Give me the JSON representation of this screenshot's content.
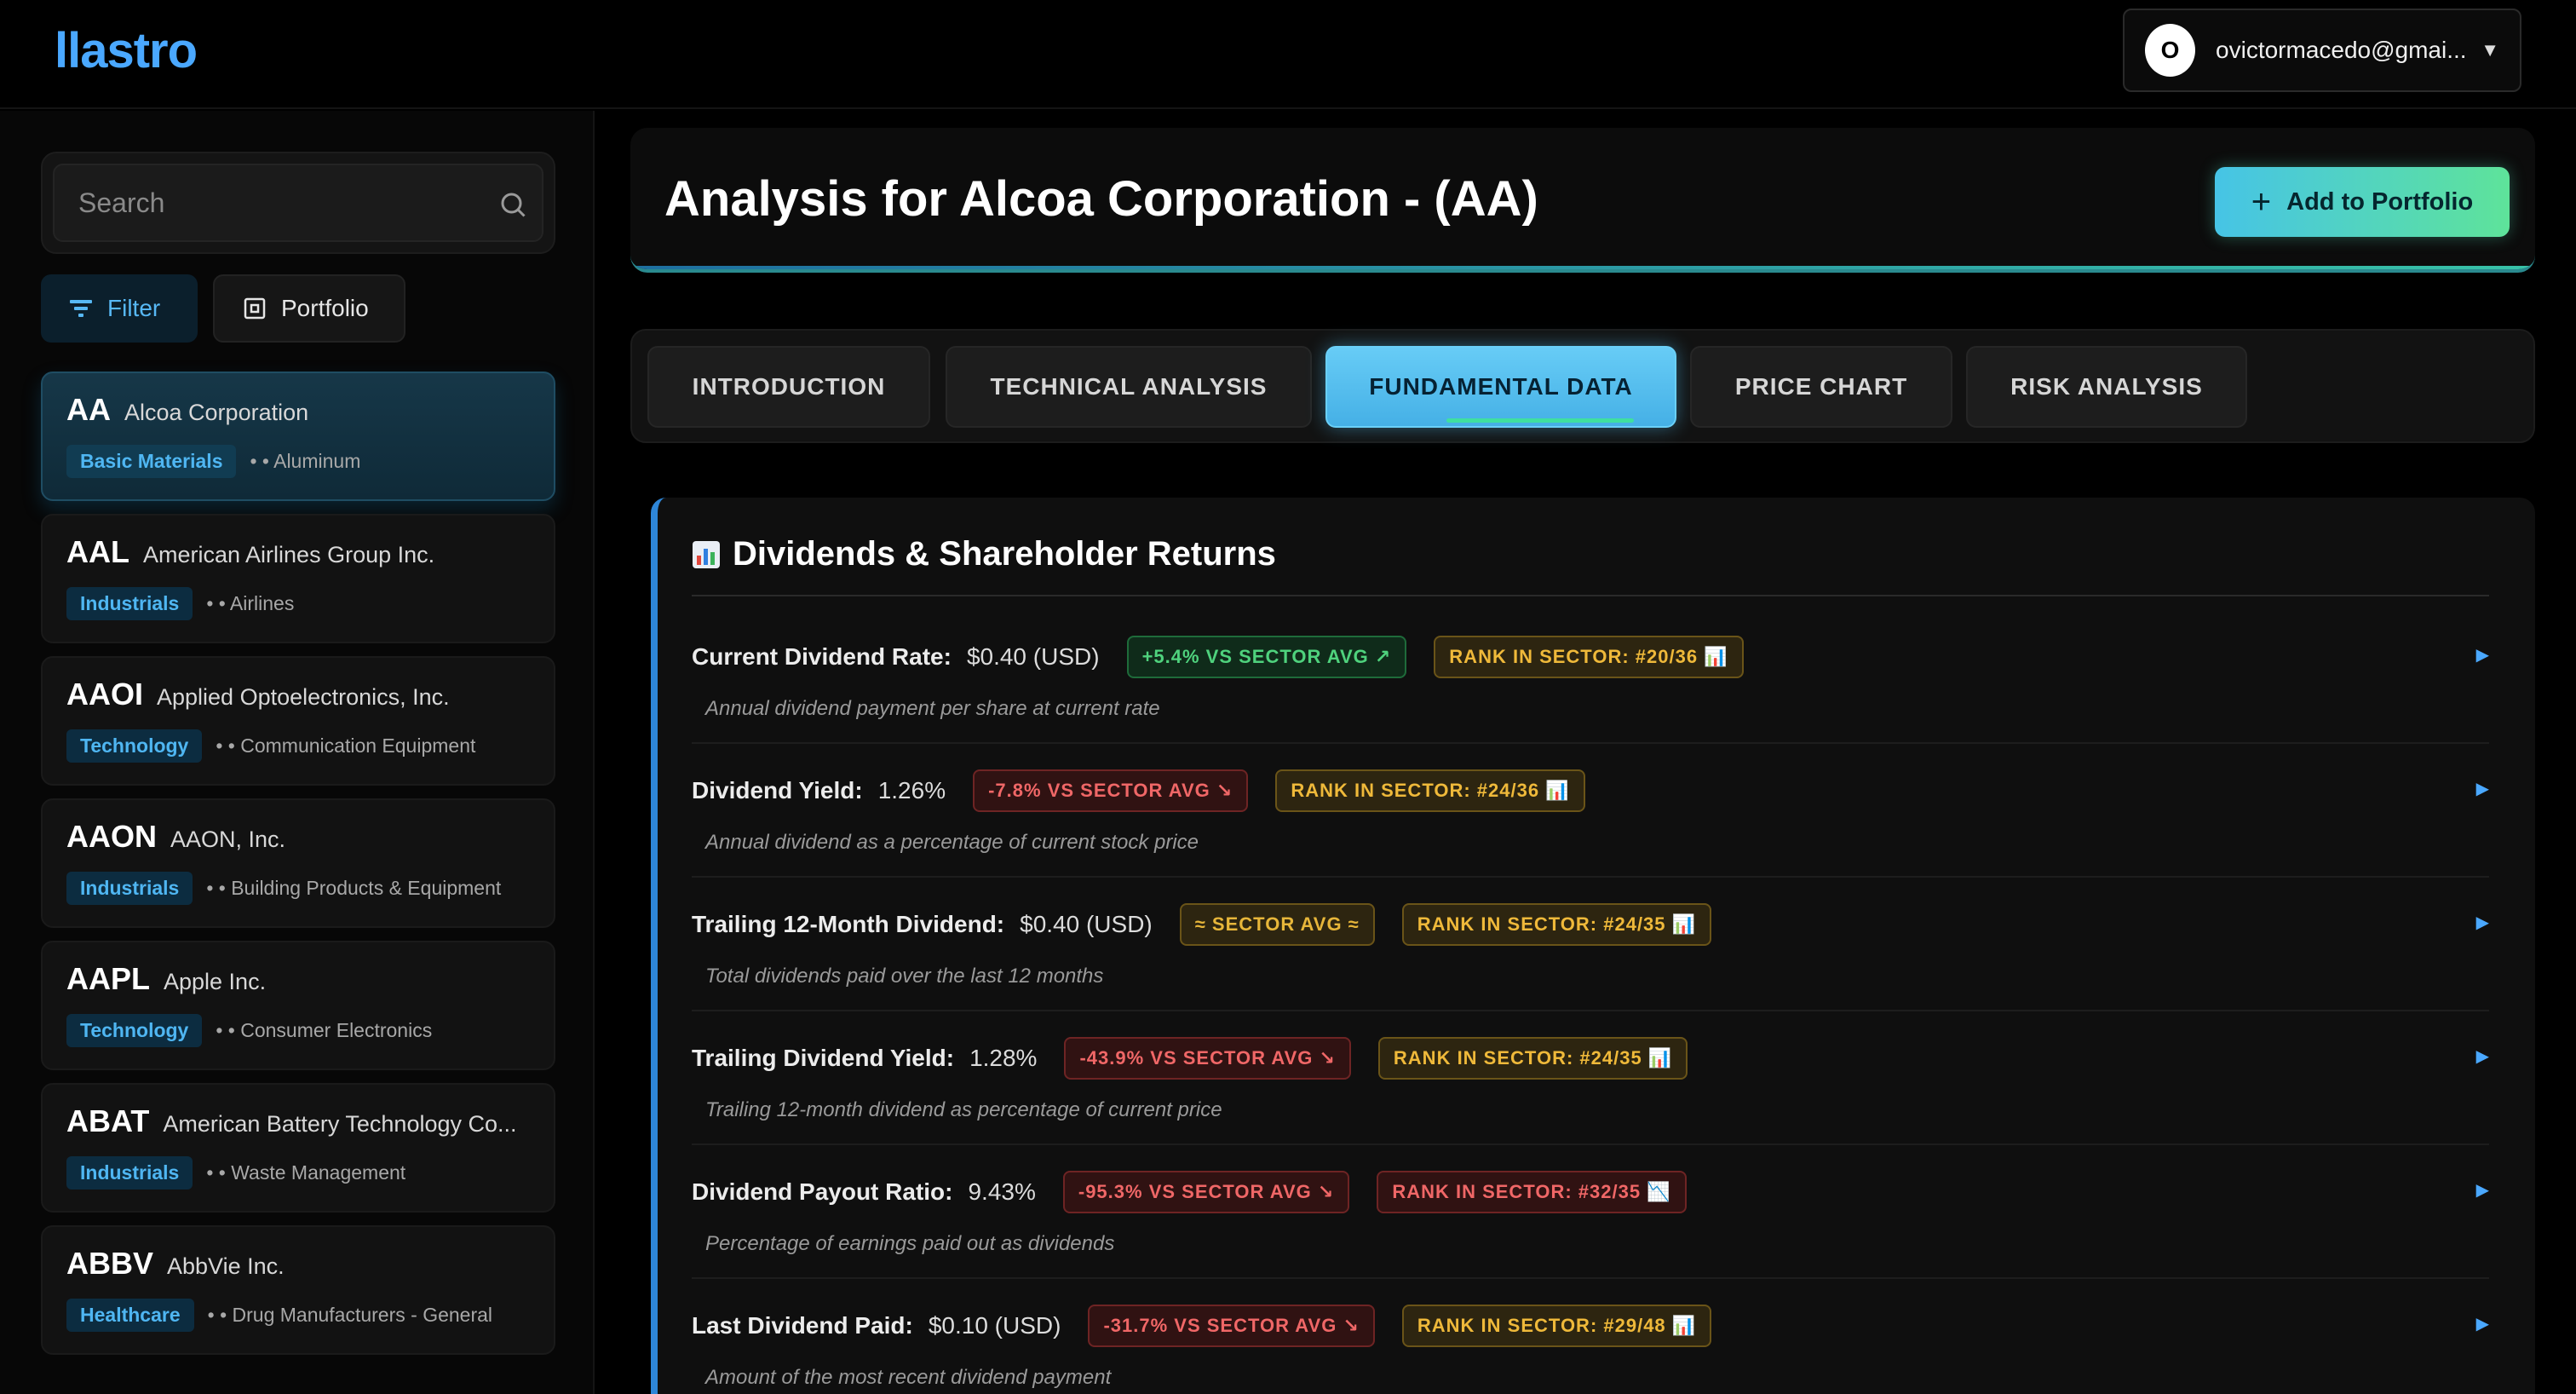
{
  "app": {
    "logo": "llastro"
  },
  "user": {
    "initial": "O",
    "email": "ovictormacedo@gmai...",
    "caret": "▼"
  },
  "sidebar": {
    "search_placeholder": "Search",
    "filter_label": "Filter",
    "portfolio_label": "Portfolio",
    "stocks": [
      {
        "ticker": "AA",
        "name": "Alcoa Corporation",
        "sector": "Basic Materials",
        "industry": "• • Aluminum"
      },
      {
        "ticker": "AAL",
        "name": "American Airlines Group Inc.",
        "sector": "Industrials",
        "industry": "• • Airlines"
      },
      {
        "ticker": "AAOI",
        "name": "Applied Optoelectronics, Inc.",
        "sector": "Technology",
        "industry": "• • Communication Equipment"
      },
      {
        "ticker": "AAON",
        "name": "AAON, Inc.",
        "sector": "Industrials",
        "industry": "• • Building Products & Equipment"
      },
      {
        "ticker": "AAPL",
        "name": "Apple Inc.",
        "sector": "Technology",
        "industry": "• • Consumer Electronics"
      },
      {
        "ticker": "ABAT",
        "name": "American Battery Technology Co...",
        "sector": "Industrials",
        "industry": "• • Waste Management"
      },
      {
        "ticker": "ABBV",
        "name": "AbbVie Inc.",
        "sector": "Healthcare",
        "industry": "• • Drug Manufacturers - General"
      }
    ]
  },
  "main": {
    "title": "Analysis for Alcoa Corporation - (AA)",
    "add_button": "Add to Portfolio",
    "tabs": [
      {
        "label": "INTRODUCTION"
      },
      {
        "label": "TECHNICAL ANALYSIS"
      },
      {
        "label": "FUNDAMENTAL DATA",
        "active": true
      },
      {
        "label": "PRICE CHART"
      },
      {
        "label": "RISK ANALYSIS"
      }
    ],
    "section": {
      "title": "Dividends & Shareholder Returns",
      "icon": "bar-chart-icon",
      "metrics": [
        {
          "label": "Current Dividend Rate:",
          "value": "$0.40 (USD)",
          "vs": "+5.4% VS SECTOR AVG ↗",
          "vs_tone": "green",
          "rank": "RANK IN SECTOR: #20/36 📊",
          "rank_tone": "rank",
          "desc": "Annual dividend payment per share at current rate",
          "caret": "▶"
        },
        {
          "label": "Dividend Yield:",
          "value": "1.26%",
          "vs": "-7.8% VS SECTOR AVG ↘",
          "vs_tone": "red",
          "rank": "RANK IN SECTOR: #24/36 📊",
          "rank_tone": "rank",
          "desc": "Annual dividend as a percentage of current stock price",
          "caret": "▶"
        },
        {
          "label": "Trailing 12-Month Dividend:",
          "value": "$0.40 (USD)",
          "vs": "≈ SECTOR AVG ≈",
          "vs_tone": "neutral",
          "rank": "RANK IN SECTOR: #24/35 📊",
          "rank_tone": "rank",
          "desc": "Total dividends paid over the last 12 months",
          "caret": "▶"
        },
        {
          "label": "Trailing Dividend Yield:",
          "value": "1.28%",
          "vs": "-43.9% VS SECTOR AVG ↘",
          "vs_tone": "red",
          "rank": "RANK IN SECTOR: #24/35 📊",
          "rank_tone": "rank",
          "desc": "Trailing 12-month dividend as percentage of current price",
          "caret": "▶"
        },
        {
          "label": "Dividend Payout Ratio:",
          "value": "9.43%",
          "vs": "-95.3% VS SECTOR AVG ↘",
          "vs_tone": "red",
          "rank": "RANK IN SECTOR: #32/35 📉",
          "rank_tone": "rank red",
          "desc": "Percentage of earnings paid out as dividends",
          "caret": "▶"
        },
        {
          "label": "Last Dividend Paid:",
          "value": "$0.10 (USD)",
          "vs": "-31.7% VS SECTOR AVG ↘",
          "vs_tone": "red",
          "rank": "RANK IN SECTOR: #29/48 📊",
          "rank_tone": "rank",
          "desc": "Amount of the most recent dividend payment",
          "caret": "▶"
        }
      ]
    }
  }
}
